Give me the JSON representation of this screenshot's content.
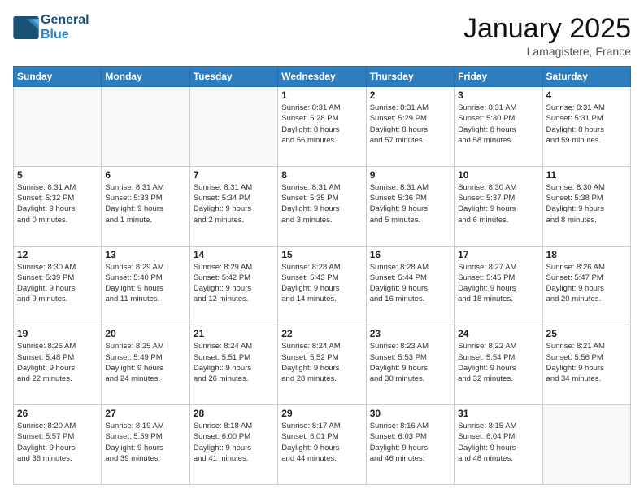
{
  "logo": {
    "line1": "General",
    "line2": "Blue"
  },
  "title": "January 2025",
  "location": "Lamagistere, France",
  "days_of_week": [
    "Sunday",
    "Monday",
    "Tuesday",
    "Wednesday",
    "Thursday",
    "Friday",
    "Saturday"
  ],
  "weeks": [
    [
      {
        "day": "",
        "info": ""
      },
      {
        "day": "",
        "info": ""
      },
      {
        "day": "",
        "info": ""
      },
      {
        "day": "1",
        "info": "Sunrise: 8:31 AM\nSunset: 5:28 PM\nDaylight: 8 hours\nand 56 minutes."
      },
      {
        "day": "2",
        "info": "Sunrise: 8:31 AM\nSunset: 5:29 PM\nDaylight: 8 hours\nand 57 minutes."
      },
      {
        "day": "3",
        "info": "Sunrise: 8:31 AM\nSunset: 5:30 PM\nDaylight: 8 hours\nand 58 minutes."
      },
      {
        "day": "4",
        "info": "Sunrise: 8:31 AM\nSunset: 5:31 PM\nDaylight: 8 hours\nand 59 minutes."
      }
    ],
    [
      {
        "day": "5",
        "info": "Sunrise: 8:31 AM\nSunset: 5:32 PM\nDaylight: 9 hours\nand 0 minutes."
      },
      {
        "day": "6",
        "info": "Sunrise: 8:31 AM\nSunset: 5:33 PM\nDaylight: 9 hours\nand 1 minute."
      },
      {
        "day": "7",
        "info": "Sunrise: 8:31 AM\nSunset: 5:34 PM\nDaylight: 9 hours\nand 2 minutes."
      },
      {
        "day": "8",
        "info": "Sunrise: 8:31 AM\nSunset: 5:35 PM\nDaylight: 9 hours\nand 3 minutes."
      },
      {
        "day": "9",
        "info": "Sunrise: 8:31 AM\nSunset: 5:36 PM\nDaylight: 9 hours\nand 5 minutes."
      },
      {
        "day": "10",
        "info": "Sunrise: 8:30 AM\nSunset: 5:37 PM\nDaylight: 9 hours\nand 6 minutes."
      },
      {
        "day": "11",
        "info": "Sunrise: 8:30 AM\nSunset: 5:38 PM\nDaylight: 9 hours\nand 8 minutes."
      }
    ],
    [
      {
        "day": "12",
        "info": "Sunrise: 8:30 AM\nSunset: 5:39 PM\nDaylight: 9 hours\nand 9 minutes."
      },
      {
        "day": "13",
        "info": "Sunrise: 8:29 AM\nSunset: 5:40 PM\nDaylight: 9 hours\nand 11 minutes."
      },
      {
        "day": "14",
        "info": "Sunrise: 8:29 AM\nSunset: 5:42 PM\nDaylight: 9 hours\nand 12 minutes."
      },
      {
        "day": "15",
        "info": "Sunrise: 8:28 AM\nSunset: 5:43 PM\nDaylight: 9 hours\nand 14 minutes."
      },
      {
        "day": "16",
        "info": "Sunrise: 8:28 AM\nSunset: 5:44 PM\nDaylight: 9 hours\nand 16 minutes."
      },
      {
        "day": "17",
        "info": "Sunrise: 8:27 AM\nSunset: 5:45 PM\nDaylight: 9 hours\nand 18 minutes."
      },
      {
        "day": "18",
        "info": "Sunrise: 8:26 AM\nSunset: 5:47 PM\nDaylight: 9 hours\nand 20 minutes."
      }
    ],
    [
      {
        "day": "19",
        "info": "Sunrise: 8:26 AM\nSunset: 5:48 PM\nDaylight: 9 hours\nand 22 minutes."
      },
      {
        "day": "20",
        "info": "Sunrise: 8:25 AM\nSunset: 5:49 PM\nDaylight: 9 hours\nand 24 minutes."
      },
      {
        "day": "21",
        "info": "Sunrise: 8:24 AM\nSunset: 5:51 PM\nDaylight: 9 hours\nand 26 minutes."
      },
      {
        "day": "22",
        "info": "Sunrise: 8:24 AM\nSunset: 5:52 PM\nDaylight: 9 hours\nand 28 minutes."
      },
      {
        "day": "23",
        "info": "Sunrise: 8:23 AM\nSunset: 5:53 PM\nDaylight: 9 hours\nand 30 minutes."
      },
      {
        "day": "24",
        "info": "Sunrise: 8:22 AM\nSunset: 5:54 PM\nDaylight: 9 hours\nand 32 minutes."
      },
      {
        "day": "25",
        "info": "Sunrise: 8:21 AM\nSunset: 5:56 PM\nDaylight: 9 hours\nand 34 minutes."
      }
    ],
    [
      {
        "day": "26",
        "info": "Sunrise: 8:20 AM\nSunset: 5:57 PM\nDaylight: 9 hours\nand 36 minutes."
      },
      {
        "day": "27",
        "info": "Sunrise: 8:19 AM\nSunset: 5:59 PM\nDaylight: 9 hours\nand 39 minutes."
      },
      {
        "day": "28",
        "info": "Sunrise: 8:18 AM\nSunset: 6:00 PM\nDaylight: 9 hours\nand 41 minutes."
      },
      {
        "day": "29",
        "info": "Sunrise: 8:17 AM\nSunset: 6:01 PM\nDaylight: 9 hours\nand 44 minutes."
      },
      {
        "day": "30",
        "info": "Sunrise: 8:16 AM\nSunset: 6:03 PM\nDaylight: 9 hours\nand 46 minutes."
      },
      {
        "day": "31",
        "info": "Sunrise: 8:15 AM\nSunset: 6:04 PM\nDaylight: 9 hours\nand 48 minutes."
      },
      {
        "day": "",
        "info": ""
      }
    ]
  ]
}
